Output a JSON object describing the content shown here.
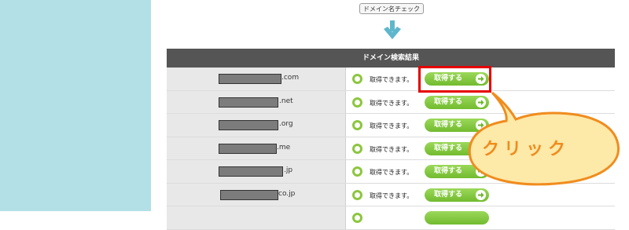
{
  "header": {
    "check_button_label": "ドメイン名チェック"
  },
  "table": {
    "title": "ドメイン検索結果",
    "rows": [
      {
        "tld": ".com",
        "status": "取得できます。",
        "action": "取得する"
      },
      {
        "tld": ".net",
        "status": "取得できます。",
        "action": "取得する"
      },
      {
        "tld": ".org",
        "status": "取得できます。",
        "action": "取得する"
      },
      {
        "tld": ".me",
        "status": "取得できます。",
        "action": "取得する"
      },
      {
        "tld": ".jp",
        "status": "取得できます。",
        "action": "取得する"
      },
      {
        "tld": "co.jp",
        "status": "取得できます。",
        "action": "取得する"
      }
    ]
  },
  "callout": {
    "label": "クリック"
  },
  "colors": {
    "sidebar": "#b2e0e6",
    "header_bg": "#555555",
    "button_green": "#7cc23a",
    "status_circle": "#8cc63f",
    "highlight_red": "#e60000",
    "bubble_fill": "#fde9a8",
    "bubble_stroke": "#f08c1e",
    "arrow_blue": "#5fb7cc"
  }
}
